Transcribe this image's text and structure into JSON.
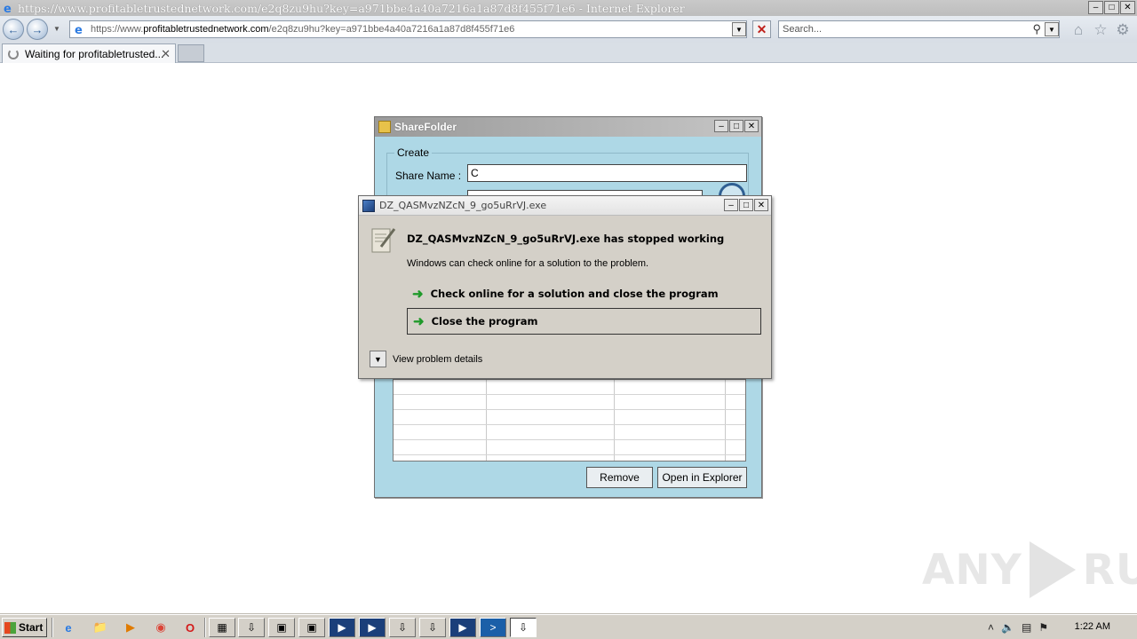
{
  "browser": {
    "window_title": "https://www.profitabletrustednetwork.com/e2q8zu9hu?key=a971bbe4a40a7216a1a87d8f455f71e6 - Internet Explorer",
    "address": {
      "url_prefix": "https://www.",
      "url_domain": "profitabletrustednetwork.com",
      "url_path": "/e2q8zu9hu?key=a971bbe4a40a7216a1a87d8f455f71e6"
    },
    "search_placeholder": "Search...",
    "tab": {
      "label": "Waiting for profitabletrusted..."
    }
  },
  "sharefolder": {
    "title": "ShareFolder",
    "group_label": "Create",
    "share_name_label": "Share Name :",
    "share_name_value": "C",
    "remove_button": "Remove",
    "open_button": "Open in Explorer"
  },
  "error_dialog": {
    "title": "DZ_QASMvzNZcN_9_go5uRrVJ.exe",
    "heading": "DZ_QASMvzNZcN_9_go5uRrVJ.exe has stopped working",
    "subtext": "Windows can check online for a solution to the problem.",
    "options": [
      {
        "label": "Check online for a solution and close the program"
      },
      {
        "label": "Close the program"
      }
    ],
    "details_label": "View problem details"
  },
  "watermark": {
    "left": "ANY",
    "right": "RUN"
  },
  "taskbar": {
    "start_label": "Start",
    "clock": "1:22 AM"
  },
  "colors": {
    "sharefolder_bg": "#aed8e6",
    "dialog_bg": "#d4d0c8",
    "green_arrow": "#1f9a2a",
    "taskbar_bg": "#d4d0c8"
  }
}
